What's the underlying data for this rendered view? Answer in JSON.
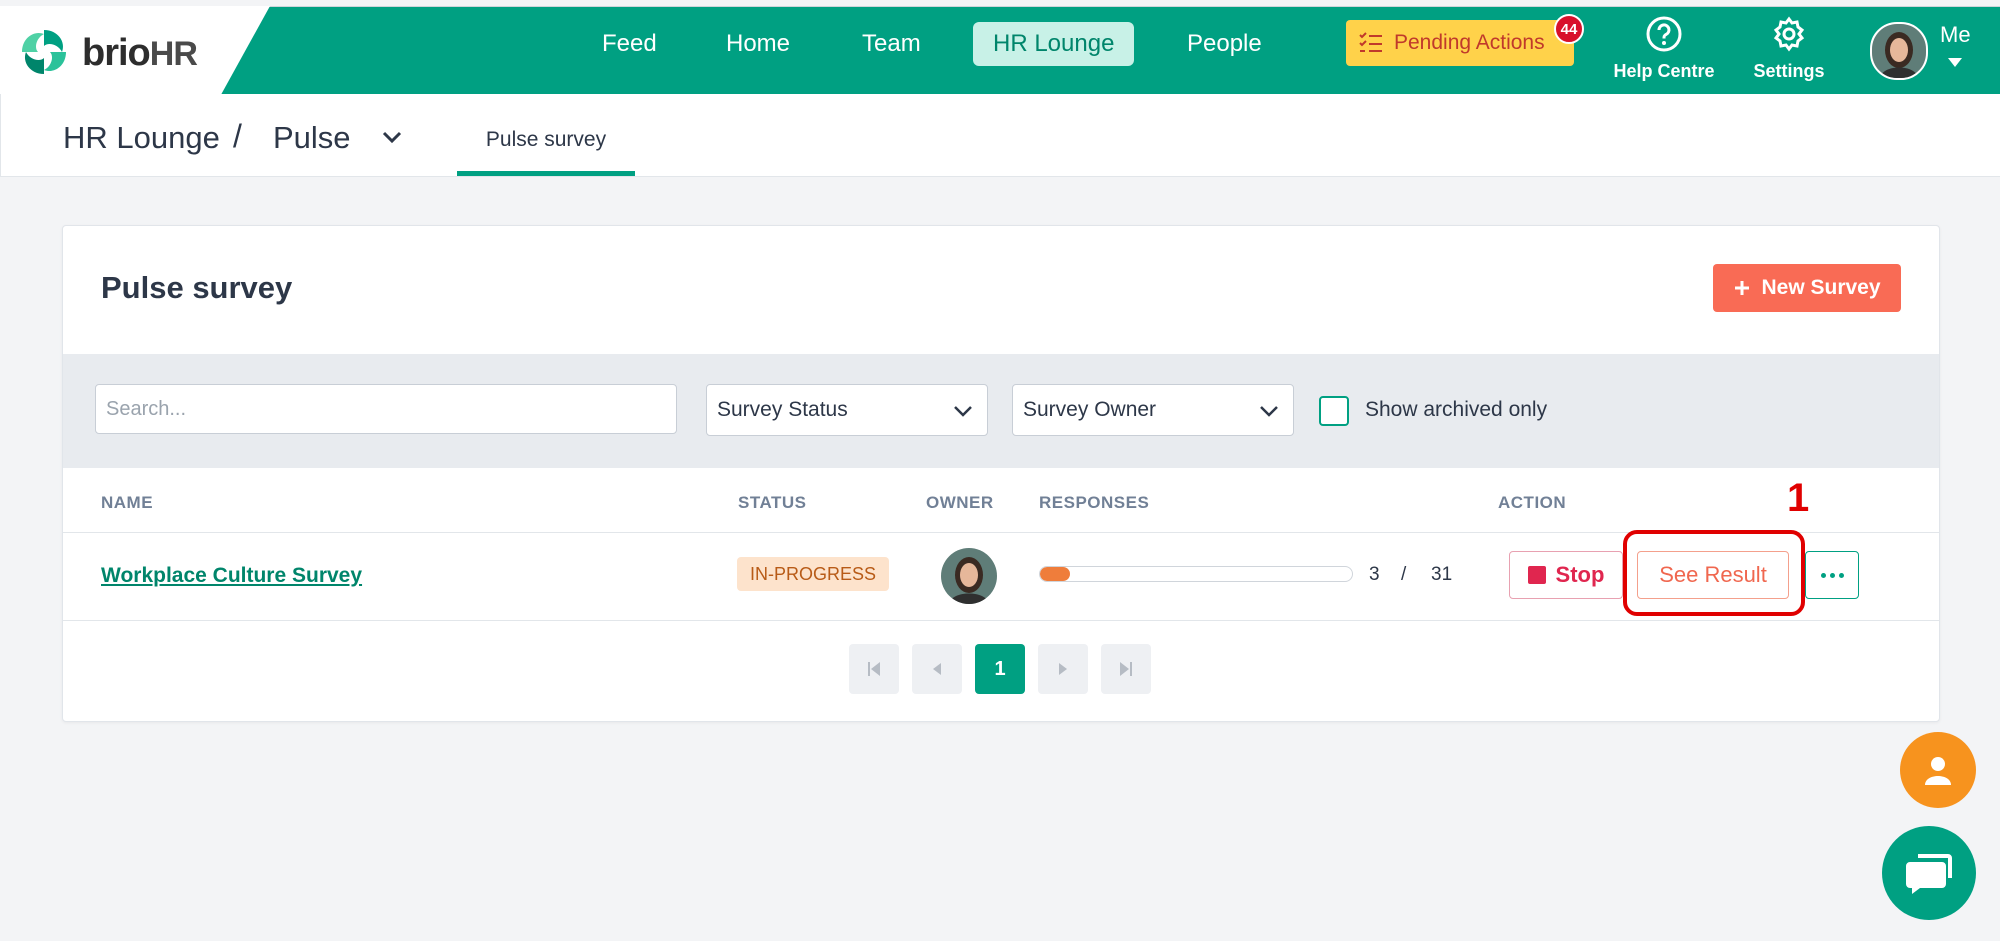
{
  "app": {
    "logo_text": "brio",
    "logo_suffix": "HR"
  },
  "nav": {
    "items": [
      "Feed",
      "Home",
      "Team",
      "HR Lounge",
      "People"
    ],
    "active": "HR Lounge",
    "pending_label": "Pending Actions",
    "pending_count": "44",
    "help_label": "Help Centre",
    "settings_label": "Settings",
    "me_label": "Me"
  },
  "breadcrumb": {
    "parent": "HR Lounge",
    "separator": "/",
    "current": "Pulse",
    "tab": "Pulse survey"
  },
  "card": {
    "title": "Pulse survey",
    "new_button": "New Survey"
  },
  "filters": {
    "search_placeholder": "Search...",
    "status_select": "Survey Status",
    "owner_select": "Survey Owner",
    "archived_label": "Show archived only"
  },
  "table": {
    "headers": [
      "NAME",
      "STATUS",
      "OWNER",
      "RESPONSES",
      "ACTION"
    ],
    "rows": [
      {
        "name": "Workplace Culture Survey",
        "status": "IN-PROGRESS",
        "responses_done": "3",
        "responses_sep": "/",
        "responses_total": "31",
        "progress_fraction": 0.097,
        "stop_label": "Stop",
        "see_label": "See Result"
      }
    ]
  },
  "annotation": {
    "label": "1"
  },
  "pagination": {
    "current": "1"
  },
  "colors": {
    "brand": "#00a082",
    "accent": "#f96b55",
    "pending": "#ffd24a",
    "annotation": "#e00000"
  },
  "icons": [
    "logo-icon",
    "pending-list-icon",
    "help-icon",
    "gear-icon",
    "avatar",
    "chevron-down-icon",
    "plus-icon",
    "stop-icon",
    "more-icon",
    "first-page-icon",
    "prev-page-icon",
    "next-page-icon",
    "last-page-icon",
    "user-icon",
    "chat-icon"
  ]
}
